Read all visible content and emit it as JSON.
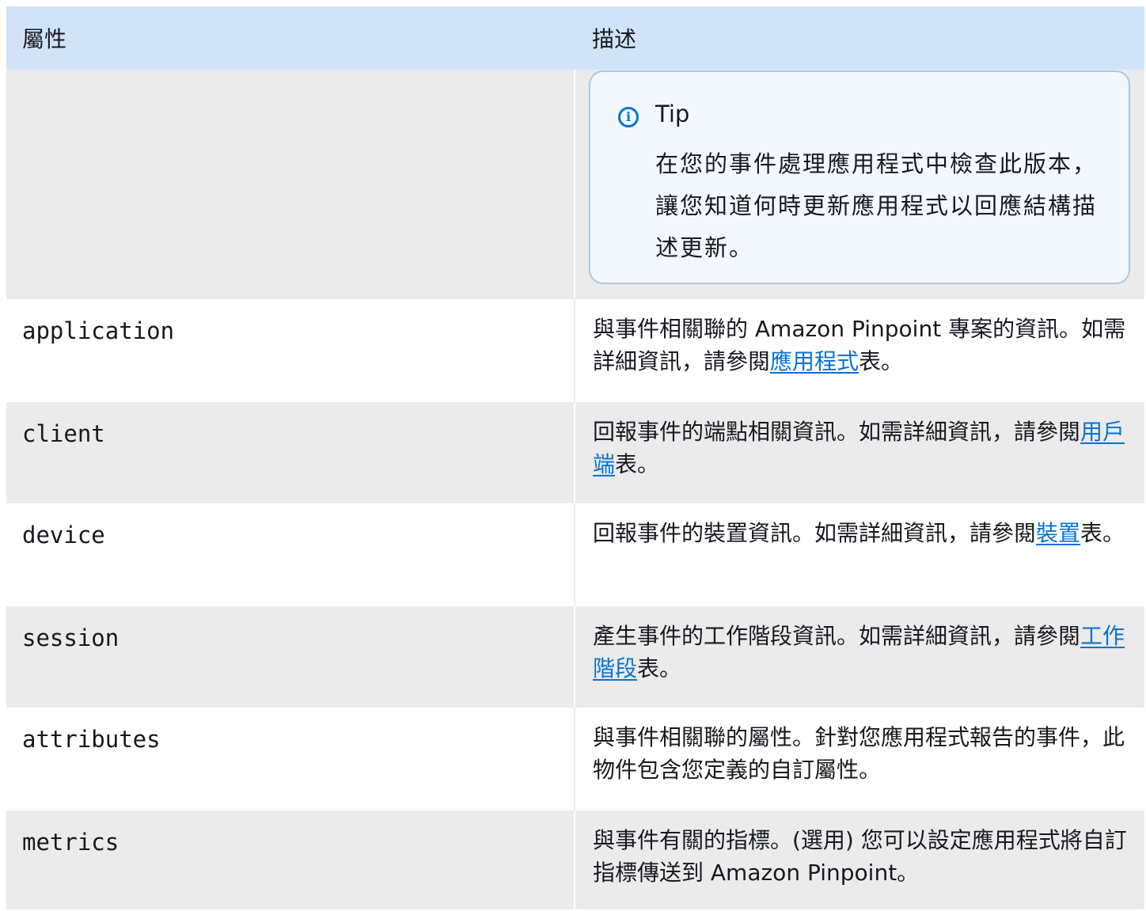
{
  "header": {
    "col_attribute": "屬性",
    "col_description": "描述"
  },
  "tip": {
    "icon": "info-icon",
    "glyph": "i",
    "title": "Tip",
    "text": "在您的事件處理應用程式中檢查此版本，讓您知道何時更新應用程式以回應結構描述更新。"
  },
  "rows": [
    {
      "name": "application",
      "desc_before": "與事件相關聯的 Amazon Pinpoint 專案的資訊。如需詳細資訊，請參閱",
      "link": "應用程式",
      "desc_after": "表。"
    },
    {
      "name": "client",
      "desc_before": "回報事件的端點相關資訊。如需詳細資訊，請參閱",
      "link": "用戶端",
      "desc_after": "表。"
    },
    {
      "name": "device",
      "desc_before": "回報事件的裝置資訊。如需詳細資訊，請參閱",
      "link": "裝置",
      "desc_after": "表。"
    },
    {
      "name": "session",
      "desc_before": "產生事件的工作階段資訊。如需詳細資訊，請參閱",
      "link": "工作階段",
      "desc_after": "表。"
    },
    {
      "name": "attributes",
      "desc_before": "與事件相關聯的屬性。針對您應用程式報告的事件，此物件包含您定義的自訂屬性。",
      "link": "",
      "desc_after": ""
    },
    {
      "name": "metrics",
      "desc_before": "與事件有關的指標。(選用) 您可以設定應用程式將自訂指標傳送到 Amazon Pinpoint。",
      "link": "",
      "desc_after": ""
    }
  ],
  "colors": {
    "header_bg": "#d1e4f7",
    "row_gray": "#ebebeb",
    "link": "#0972d3",
    "tip_border": "#a8c8e8",
    "tip_bg": "#f2f8fd"
  }
}
